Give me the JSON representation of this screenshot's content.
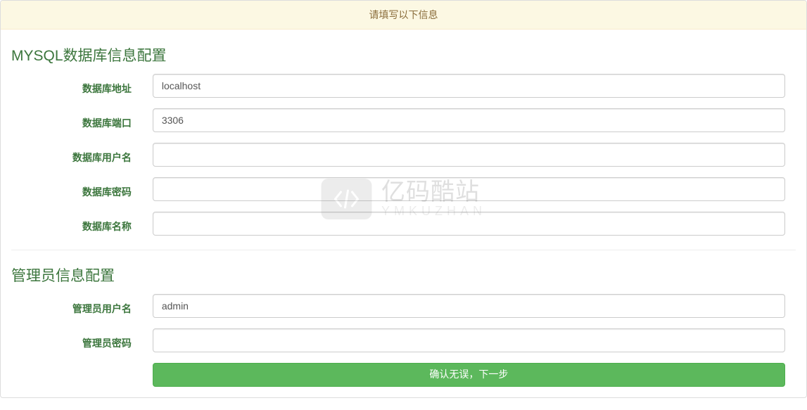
{
  "header": {
    "title": "请填写以下信息"
  },
  "sections": {
    "mysql": {
      "title": "MYSQL数据库信息配置",
      "fields": {
        "host": {
          "label": "数据库地址",
          "value": "localhost"
        },
        "port": {
          "label": "数据库端口",
          "value": "3306"
        },
        "username": {
          "label": "数据库用户名",
          "value": ""
        },
        "password": {
          "label": "数据库密码",
          "value": ""
        },
        "dbname": {
          "label": "数据库名称",
          "value": ""
        }
      }
    },
    "admin": {
      "title": "管理员信息配置",
      "fields": {
        "username": {
          "label": "管理员用户名",
          "value": "admin"
        },
        "password": {
          "label": "管理员密码",
          "value": ""
        }
      }
    }
  },
  "button": {
    "submit_label": "确认无误，下一步"
  },
  "watermark": {
    "title": "亿码酷站",
    "sub": "YMKUZHAN"
  }
}
